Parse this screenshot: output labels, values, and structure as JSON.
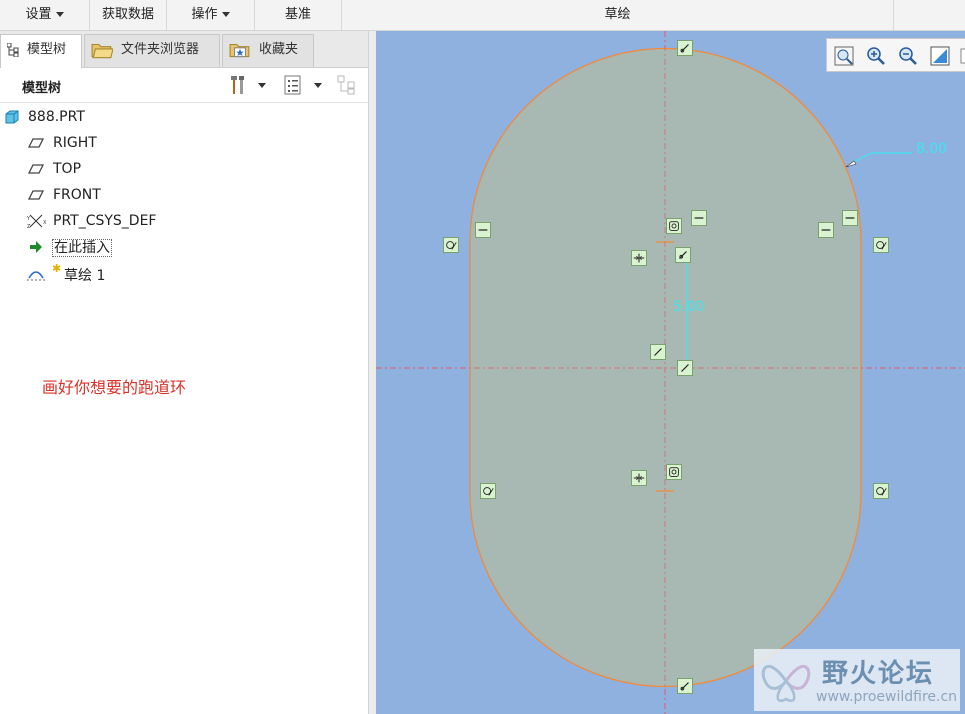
{
  "topbar": {
    "groups": [
      {
        "label": "设置",
        "dropdown": true
      },
      {
        "label": "获取数据",
        "dropdown": false
      },
      {
        "label": "操作",
        "dropdown": true
      },
      {
        "label": "基准",
        "dropdown": false
      },
      {
        "label": "草绘",
        "dropdown": false
      }
    ]
  },
  "panel": {
    "tabs": [
      {
        "label": "模型树",
        "icon": "model-tree-icon",
        "active": true
      },
      {
        "label": "文件夹浏览器",
        "icon": "folder-browser-icon",
        "active": false
      },
      {
        "label": "收藏夹",
        "icon": "favorites-icon",
        "active": false
      }
    ],
    "tree_title": "模型树",
    "tools": [
      "settings-tools-icon",
      "show-list-icon",
      "tree-filter-icon"
    ],
    "items": [
      {
        "label": "888.PRT",
        "icon": "part-icon"
      },
      {
        "label": "RIGHT",
        "icon": "datum-plane-icon"
      },
      {
        "label": "TOP",
        "icon": "datum-plane-icon"
      },
      {
        "label": "FRONT",
        "icon": "datum-plane-icon"
      },
      {
        "label": "PRT_CSYS_DEF",
        "icon": "csys-icon"
      },
      {
        "label": "在此插入",
        "icon": "insert-here-arrow-icon"
      },
      {
        "label": "草绘 1",
        "icon": "sketch-icon"
      }
    ],
    "annotation": "画好你想要的跑道环"
  },
  "canvas": {
    "view_tools": [
      "refit-icon",
      "zoom-in-icon",
      "zoom-out-icon",
      "repaint-icon"
    ],
    "dimensions": {
      "radius": "8.00",
      "offset": "5.00"
    },
    "colors": {
      "background": "#8fb1e0",
      "fill": "#a8b8b2",
      "outline": "#f08a3c",
      "centerline": "#e05a6a",
      "dimension": "#3ee6f0"
    }
  },
  "watermark": {
    "title": "野火论坛",
    "url": "www.proewildfire.cn"
  }
}
